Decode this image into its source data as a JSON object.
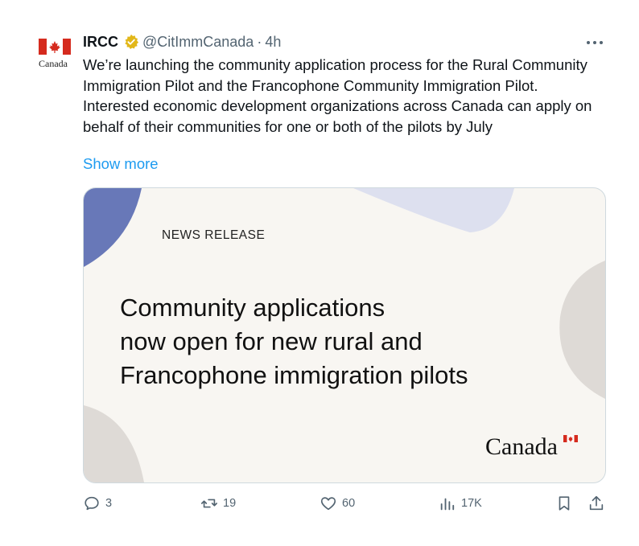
{
  "author": {
    "avatar_word": "Canada",
    "name": "IRCC",
    "handle": "@CitImmCanada",
    "separator": "·",
    "time": "4h"
  },
  "tweet": {
    "text": "We’re launching the community application process for the Rural Community Immigration Pilot and the Francophone Community Immigration Pilot. Interested economic development organizations across Canada can apply on behalf of their communities for one or both of the pilots by July",
    "show_more": "Show more"
  },
  "card": {
    "kicker": "NEWS RELEASE",
    "headline_lines": [
      "Community applications",
      "now open for new rural and",
      "Francophone immigration pilots"
    ],
    "wordmark": "Canada"
  },
  "metrics": {
    "replies": "3",
    "reposts": "19",
    "likes": "60",
    "views": "17K"
  },
  "icons": {
    "more": "more-horizontal-icon",
    "reply": "reply-icon",
    "repost": "repost-icon",
    "like": "heart-icon",
    "views": "views-chart-icon",
    "bookmark": "bookmark-icon",
    "share": "share-icon",
    "verified": "verified-badge-icon"
  },
  "colors": {
    "link": "#1d9bf0",
    "muted": "#536471",
    "canada_red": "#d52b1e",
    "badge_gold": "#e2b719"
  }
}
